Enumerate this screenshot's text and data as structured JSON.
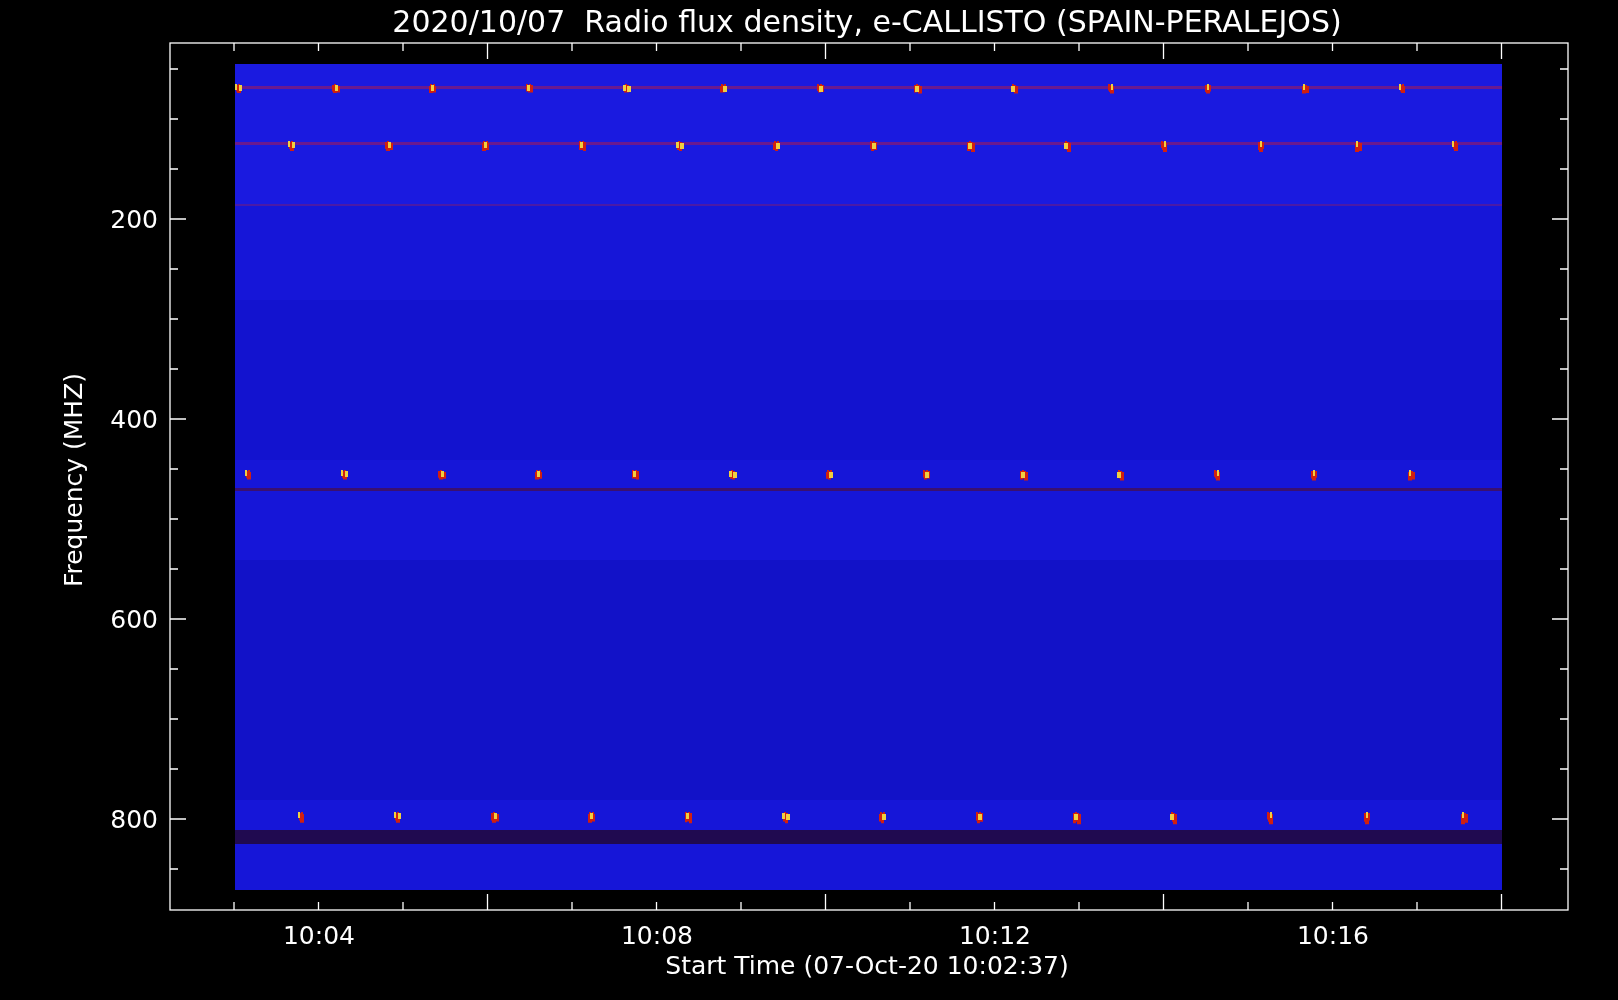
{
  "title": "2020/10/07  Radio flux density, e-CALLISTO (SPAIN-PERALEJOS)",
  "y_axis": {
    "label": "Frequency (MHZ)",
    "ticks": [
      "200",
      "400",
      "600",
      "800"
    ]
  },
  "x_axis": {
    "label": "Start Time (07-Oct-20 10:02:37)",
    "ticks": [
      "10:04",
      "10:08",
      "10:12",
      "10:16"
    ]
  }
}
